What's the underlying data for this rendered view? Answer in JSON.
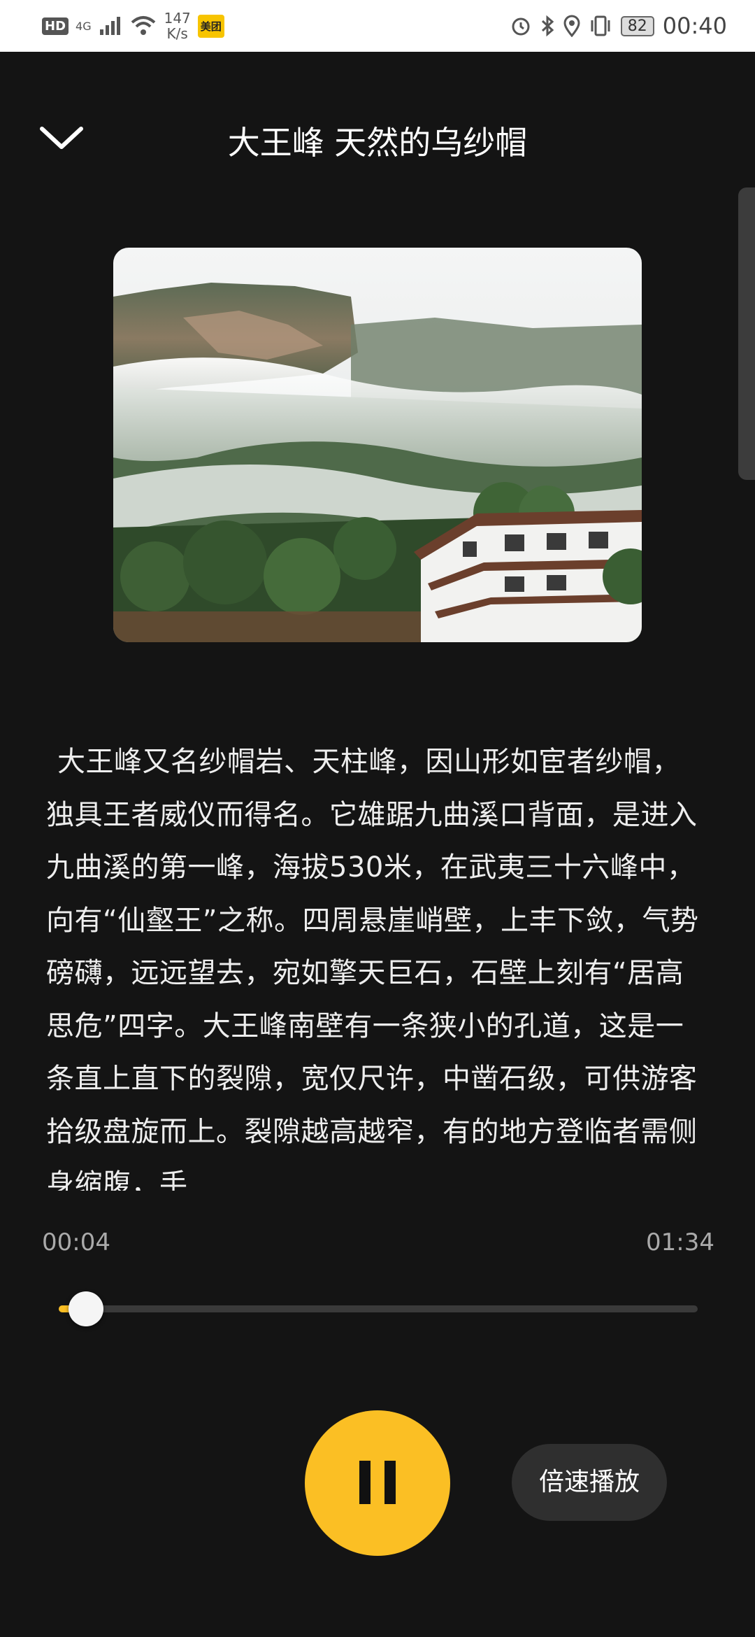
{
  "status_bar": {
    "hd": "HD",
    "network": "4G",
    "speed_value": "147",
    "speed_unit": "K/s",
    "app_badge": "美团",
    "battery": "82",
    "time": "00:40"
  },
  "header": {
    "title": "大王峰 天然的乌纱帽"
  },
  "cover_image": {
    "icon": "mountain-photo"
  },
  "description": "大王峰又名纱帽岩、天柱峰，因山形如宦者纱帽，独具王者威仪而得名。它雄踞九曲溪口背面，是进入九曲溪的第一峰，海拔530米，在武夷三十六峰中，向有“仙壑王”之称。四周悬崖峭壁，上丰下敛，气势磅礴，远远望去，宛如擎天巨石，石壁上刻有“居高思危”四字。大王峰南壁有一条狭小的孔道，这是一条直上直下的裂隙，宽仅尺许，中凿石级，可供游客拾级盘旋而上。裂隙越高越窄，有的地方登临者需侧身缩腹，手",
  "player": {
    "current_time": "00:04",
    "total_time": "01:34",
    "progress": 0.043,
    "accent_color": "#fbbf24",
    "speed_label": "倍速播放"
  }
}
